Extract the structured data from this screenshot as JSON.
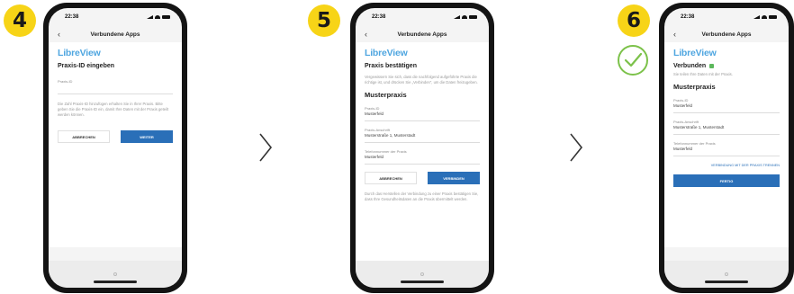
{
  "steps": [
    {
      "number": "4",
      "status_time": "22:38",
      "nav_title": "Verbundene Apps",
      "brand": "LibreView",
      "heading": "Praxis-ID eingeben",
      "field_label": "Praxis-ID",
      "body_text": "Die Zahl Praxis-ID hinzufügen erhalten Sie in Ihrer Praxis. Bitte geben Sie die Praxis-ID ein, damit Ihre Daten mit der Praxis geteilt werden können.",
      "cancel_label": "ABBRECHEN",
      "next_label": "WEITER"
    },
    {
      "number": "5",
      "status_time": "22:38",
      "nav_title": "Verbundene Apps",
      "brand": "LibreView",
      "heading": "Praxis bestätigen",
      "body_text": "Vergewissern Sie sich, dass die nachfolgend aufgeführte Praxis die richtige ist, und drücken Sie „Verbinden“, um die Daten freizugeben.",
      "practice_name": "Musterpraxis",
      "fields": [
        {
          "label": "Praxis-ID",
          "value": "Musterfeld"
        },
        {
          "label": "Praxis-Anschrift",
          "value": "Musterstraße 1, Musterstadt"
        },
        {
          "label": "Telefonnummer der Praxis",
          "value": "Musterfeld"
        }
      ],
      "cancel_label": "ABBRECHEN",
      "connect_label": "VERBINDEN",
      "footer_text": "Durch das Herstellen der Verbindung zu einer Praxis bestätigen Sie, dass Ihre Gesundheitsdaten an die Praxis übermittelt werden."
    },
    {
      "number": "6",
      "status_time": "22:38",
      "nav_title": "Verbundene Apps",
      "brand": "LibreView",
      "connected_label": "Verbunden",
      "connected_text": "Sie teilen Ihre Daten mit der Praxis.",
      "practice_name": "Musterpraxis",
      "fields": [
        {
          "label": "Praxis-ID",
          "value": "Musterfeld"
        },
        {
          "label": "Praxis-Anschrift",
          "value": "Musterstraße 1, Musterstadt"
        },
        {
          "label": "Telefonnummer der Praxis",
          "value": "Musterfeld"
        }
      ],
      "disconnect_link": "VERBINDUNG MIT DER PRAXIS TRENNEN",
      "done_label": "FERTIG"
    }
  ],
  "colors": {
    "badge": "#f7d417",
    "check": "#7cc24a",
    "brand": "#4fa6e0",
    "primary_button": "#2a6fb8"
  },
  "icons": [
    "chevron-right-icon",
    "check-circle-icon",
    "back-arrow-icon"
  ]
}
